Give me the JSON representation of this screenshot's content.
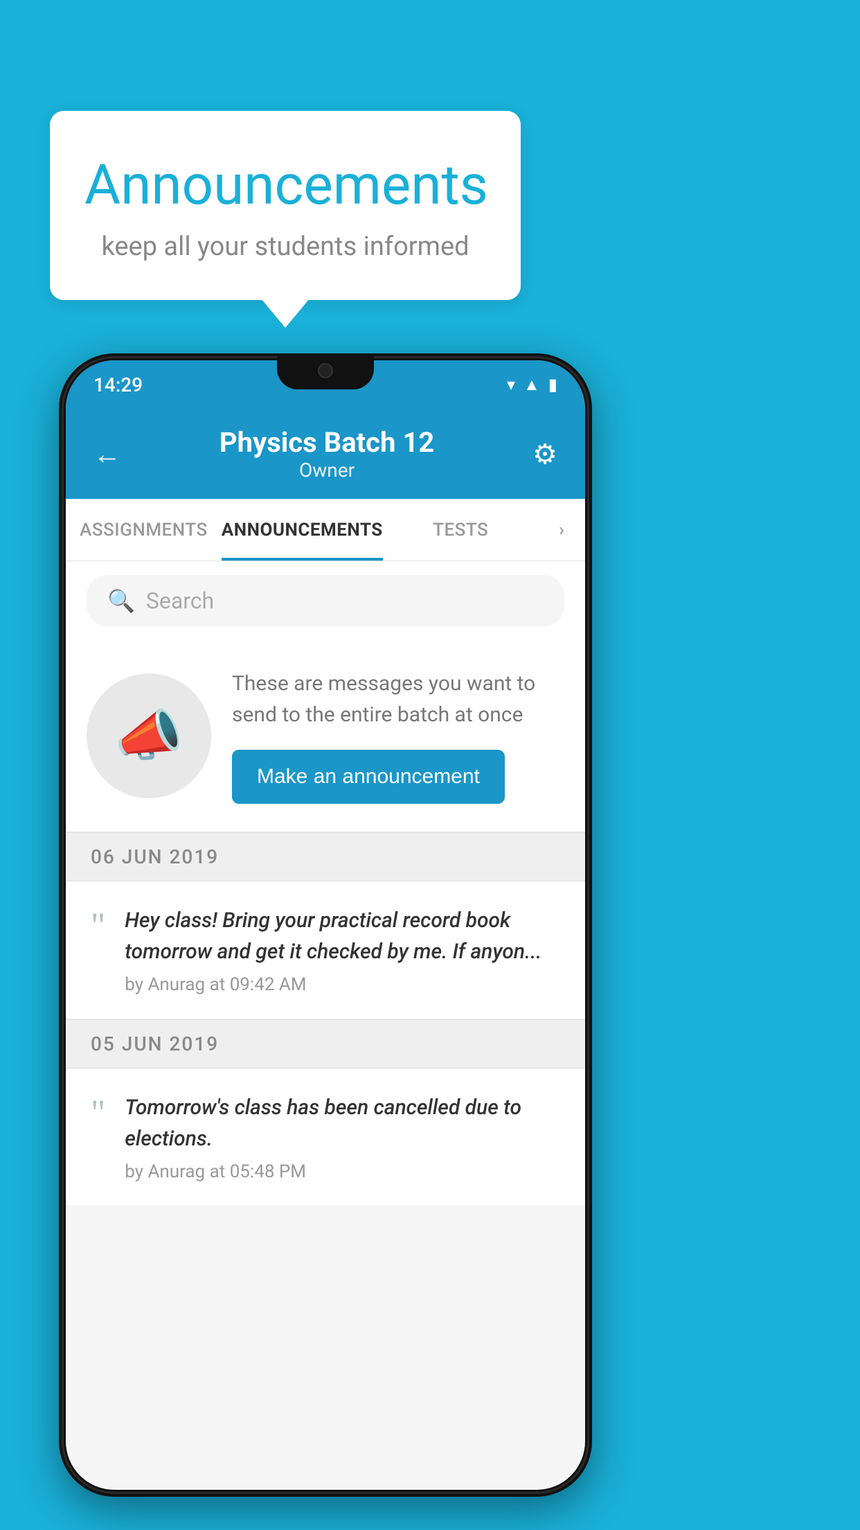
{
  "background_color": "#1ab0d8",
  "speech_bubble": {
    "title": "Announcements",
    "subtitle": "keep all your students informed"
  },
  "phone": {
    "status_bar": {
      "time": "14:29",
      "wifi": "▾",
      "signal": "▲",
      "battery": "▮"
    },
    "header": {
      "back_icon": "←",
      "title": "Physics Batch 12",
      "subtitle": "Owner",
      "settings_icon": "⚙"
    },
    "tabs": [
      {
        "label": "ASSIGNMENTS",
        "active": false
      },
      {
        "label": "ANNOUNCEMENTS",
        "active": true
      },
      {
        "label": "TESTS",
        "active": false
      },
      {
        "label": "›",
        "active": false
      }
    ],
    "search": {
      "placeholder": "Search",
      "icon": "🔍"
    },
    "promo": {
      "text": "These are messages you want to send to the entire batch at once",
      "button_label": "Make an announcement"
    },
    "announcements": [
      {
        "date": "06  JUN  2019",
        "items": [
          {
            "text": "Hey class! Bring your practical record book tomorrow and get it checked by me. If anyon...",
            "meta": "by Anurag at 09:42 AM"
          }
        ]
      },
      {
        "date": "05  JUN  2019",
        "items": [
          {
            "text": "Tomorrow's class has been cancelled due to elections.",
            "meta": "by Anurag at 05:48 PM"
          }
        ]
      }
    ]
  }
}
